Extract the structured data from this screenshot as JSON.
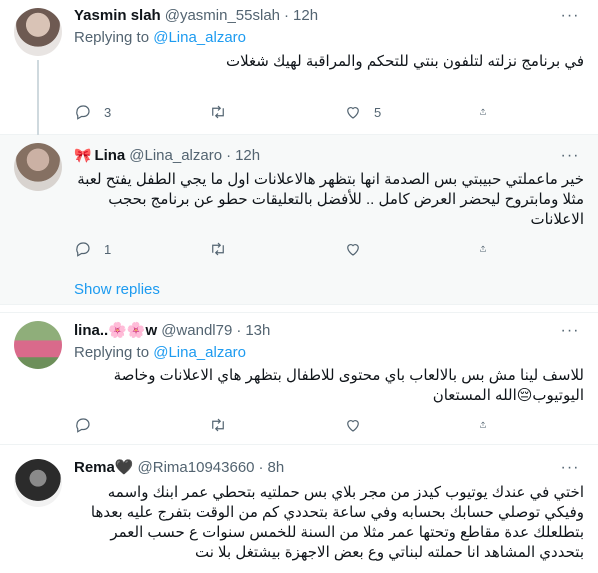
{
  "tweets": [
    {
      "name": "Yasmin slah",
      "handle": "@yasmin_55slah",
      "dot": "·",
      "time": "12h",
      "replying_prefix": "Replying to",
      "replying_to": "@Lina_alzaro",
      "text": "في برنامج نزلته لتلفون بنتي للتحكم والمراقبة لهيك شغلات",
      "replies": "3",
      "retweets": "",
      "likes": "5"
    },
    {
      "badge": "🎀",
      "name": "Lina",
      "handle": "@Lina_alzaro",
      "dot": "·",
      "time": "12h",
      "text": "خير ماعملتي حبيبتي بس الصدمة انها بتظهر هالاعلانات اول ما يجي الطفل يفتح لعبة مثلا ومابتروح ليحضر العرض كامل .. للأفضل بالتعليقات حطو عن برنامج بحجب الاعلانات",
      "replies": "1",
      "retweets": "",
      "likes": "",
      "show_replies": "Show replies"
    },
    {
      "name": "lina..🌸🌸w",
      "handle": "@wandl79",
      "dot": "·",
      "time": "13h",
      "replying_prefix": "Replying to",
      "replying_to": "@Lina_alzaro",
      "text": "للاسف لينا مش بس بالالعاب باي محتوى للاطفال بتظهر هاي الاعلانات وخاصة اليوتيوب😔الله المستعان",
      "replies": "",
      "retweets": "",
      "likes": ""
    },
    {
      "name": "Rema🖤",
      "handle": "@Rima10943660",
      "dot": "·",
      "time": "8h",
      "text": "اختي في عندك يوتيوب كيدز من مجر بلاي بس حملتيه بتحطي عمر ابنك واسمه وفيكي توصلي حسابك بحسابه وفي ساعة بتحددي كم من الوقت بتفرج عليه بعدها بتطلعلك عدة مقاطع وتحتها عمر مثلا من السنة للخمس سنوات ع حسب العمر بتحددي المشاهد انا حملته لبناتي وع بعض الاجهزة بيشتغل بلا نت"
    }
  ],
  "colors": {
    "link": "#1d9bf0",
    "muted": "#536471",
    "text": "#0f1419",
    "highlight_bg": "#f7f9f9"
  },
  "icons": [
    "more-icon",
    "reply-icon",
    "retweet-icon",
    "like-icon",
    "share-icon"
  ]
}
